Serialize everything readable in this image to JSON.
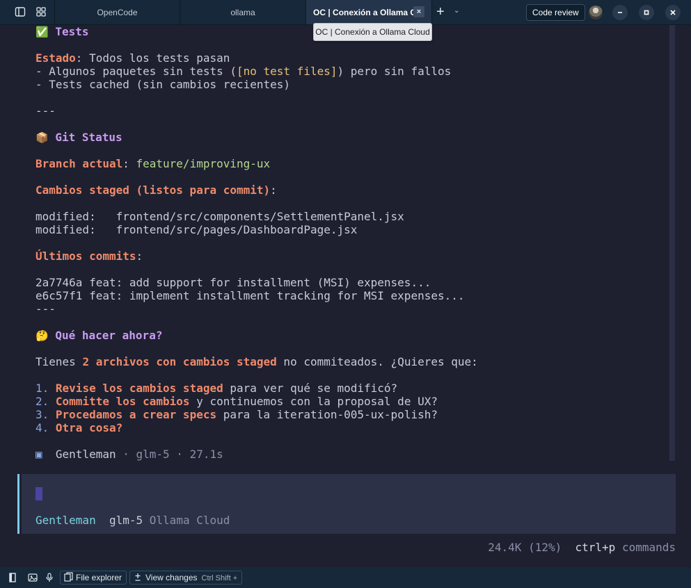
{
  "tabs": [
    {
      "label": "OpenCode"
    },
    {
      "label": "ollama"
    },
    {
      "label": "OC | Conexión a Ollama Cloud"
    }
  ],
  "tooltip": "OC | Conexión a Ollama Cloud",
  "header": {
    "code_review": "Code review",
    "tab_close": "×",
    "new_tab": "+",
    "new_tab_menu": "⌄"
  },
  "content": {
    "tests_emoji": "✅",
    "tests_title": "Tests",
    "estado_label": "Estado",
    "estado_text": ": Todos los tests pasan",
    "tests_line2_a": "- Algunos paquetes sin tests (",
    "tests_line2_b": "[no test files]",
    "tests_line2_c": ") pero sin fallos",
    "tests_line3": "- Tests cached (sin cambios recientes)",
    "sep1": "---",
    "git_emoji": "📦",
    "git_title": "Git Status",
    "branch_label": "Branch actual",
    "branch_colon": ": ",
    "branch_value": "feature/improving-ux",
    "staged_label": "Cambios staged (listos para commit)",
    "staged_colon": ":",
    "modified1": "modified:   frontend/src/components/SettlementPanel.jsx",
    "modified2": "modified:   frontend/src/pages/DashboardPage.jsx",
    "commits_label": "Últimos commits",
    "commits_colon": ":",
    "commit1": "2a7746a feat: add support for installment (MSI) expenses...",
    "commit2": "e6c57f1 feat: implement installment tracking for MSI expenses...",
    "sep2": "---",
    "next_emoji": "🤔",
    "next_title": "Qué hacer ahora?",
    "q_a": "Tienes ",
    "q_b": "2 archivos con cambios staged",
    "q_c": " no commiteados. ¿Quieres que:",
    "options": [
      {
        "num": "1. ",
        "bold": "Revise los cambios staged",
        "rest": " para ver qué se modificó?"
      },
      {
        "num": "2. ",
        "bold": "Committe los cambios",
        "rest": " y continuemos con la proposal de UX?"
      },
      {
        "num": "3. ",
        "bold": "Procedamos a crear specs",
        "rest": " para la iteration-005-ux-polish?"
      },
      {
        "num": "4. ",
        "bold": "Otra cosa?",
        "rest": ""
      }
    ],
    "footer_icon": "▣",
    "footer_agent": "Gentleman",
    "footer_meta": " · glm-5 · 27.1s"
  },
  "input": {
    "agent": "Gentleman",
    "model": "glm-5",
    "provider": "Ollama Cloud"
  },
  "status": {
    "tokens": "24.4K (12%)",
    "shortcut": "ctrl+p",
    "shortcut_label": "commands"
  },
  "bottombar": {
    "file_explorer": "File explorer",
    "view_changes": "View changes",
    "view_changes_shortcut": "Ctrl Shift +"
  },
  "colors": {
    "background": "#1e2030",
    "heading": "#c99cf0",
    "accent": "#f08b6b",
    "branch": "#b7d98a",
    "titlebar": "#16283a"
  }
}
